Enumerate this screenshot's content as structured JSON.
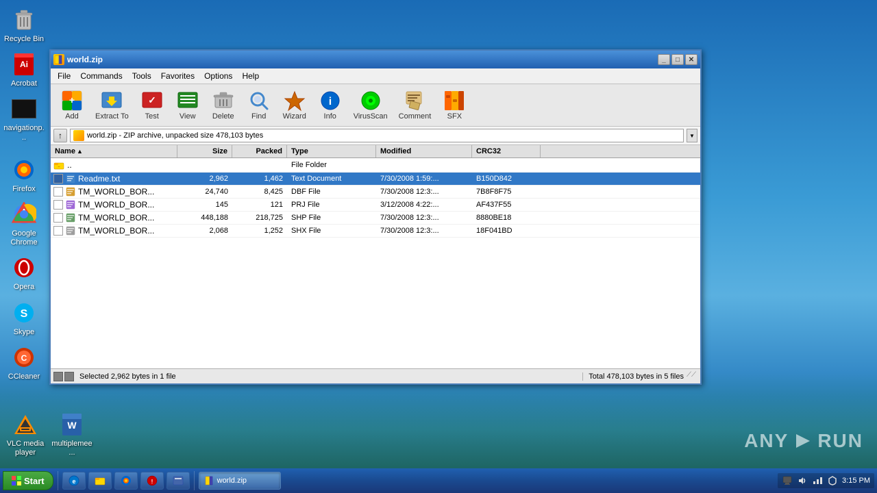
{
  "desktop": {
    "icons": [
      {
        "id": "recycle-bin",
        "label": "Recycle Bin",
        "icon": "🗑"
      },
      {
        "id": "acrobat",
        "label": "Acrobat",
        "icon": "📄"
      },
      {
        "id": "navigation",
        "label": "navigationp...",
        "icon": "⬛"
      },
      {
        "id": "firefox",
        "label": "Firefox",
        "icon": "🦊"
      },
      {
        "id": "google-chrome",
        "label": "Google Chrome",
        "icon": "🌐"
      },
      {
        "id": "opera",
        "label": "Opera",
        "icon": "O"
      },
      {
        "id": "skype",
        "label": "Skype",
        "icon": "S"
      },
      {
        "id": "ccleaner",
        "label": "CCleaner",
        "icon": "C"
      }
    ],
    "bottom_icons": [
      {
        "id": "vlc",
        "label": "VLC media player",
        "icon": "🔶"
      },
      {
        "id": "multiplemee",
        "label": "multiplemee...",
        "icon": "📝"
      }
    ]
  },
  "winrar": {
    "title": "world.zip",
    "address": "world.zip - ZIP archive, unpacked size 478,103 bytes",
    "menus": [
      "File",
      "Commands",
      "Tools",
      "Favorites",
      "Options",
      "Help"
    ],
    "toolbar": [
      {
        "id": "add",
        "label": "Add",
        "icon": "➕"
      },
      {
        "id": "extract-to",
        "label": "Extract To",
        "icon": "📤"
      },
      {
        "id": "test",
        "label": "Test",
        "icon": "✔"
      },
      {
        "id": "view",
        "label": "View",
        "icon": "📋"
      },
      {
        "id": "delete",
        "label": "Delete",
        "icon": "🗑"
      },
      {
        "id": "find",
        "label": "Find",
        "icon": "🔍"
      },
      {
        "id": "wizard",
        "label": "Wizard",
        "icon": "⚡"
      },
      {
        "id": "info",
        "label": "Info",
        "icon": "ℹ"
      },
      {
        "id": "virusscan",
        "label": "VirusScan",
        "icon": "🛡"
      },
      {
        "id": "comment",
        "label": "Comment",
        "icon": "💬"
      },
      {
        "id": "sfx",
        "label": "SFX",
        "icon": "📦"
      }
    ],
    "columns": [
      "Name",
      "Size",
      "Packed",
      "Type",
      "Modified",
      "CRC32"
    ],
    "files": [
      {
        "id": "parent",
        "name": "..",
        "size": "",
        "packed": "",
        "type": "File Folder",
        "modified": "",
        "crc32": "",
        "selected": false,
        "is_parent": true
      },
      {
        "id": "readme",
        "name": "Readme.txt",
        "size": "2,962",
        "packed": "1,462",
        "type": "Text Document",
        "modified": "7/30/2008 1:59:...",
        "crc32": "B150D842",
        "selected": true
      },
      {
        "id": "file2",
        "name": "TM_WORLD_BOR...",
        "size": "24,740",
        "packed": "8,425",
        "type": "DBF File",
        "modified": "7/30/2008 12:3:...",
        "crc32": "7B8F8F75",
        "selected": false
      },
      {
        "id": "file3",
        "name": "TM_WORLD_BOR...",
        "size": "145",
        "packed": "121",
        "type": "PRJ File",
        "modified": "3/12/2008 4:22:...",
        "crc32": "AF437F55",
        "selected": false
      },
      {
        "id": "file4",
        "name": "TM_WORLD_BOR...",
        "size": "448,188",
        "packed": "218,725",
        "type": "SHP File",
        "modified": "7/30/2008 12:3:...",
        "crc32": "8880BE18",
        "selected": false
      },
      {
        "id": "file5",
        "name": "TM_WORLD_BOR...",
        "size": "2,068",
        "packed": "1,252",
        "type": "SHX File",
        "modified": "7/30/2008 12:3:...",
        "crc32": "18F041BD",
        "selected": false
      }
    ],
    "status_left": "Selected 2,962 bytes in 1 file",
    "status_right": "Total 478,103 bytes in 5 files"
  },
  "taskbar": {
    "start_label": "Start",
    "buttons": [
      {
        "id": "ie",
        "label": "🌐",
        "active": false
      },
      {
        "id": "explorer",
        "label": "📁",
        "active": false
      },
      {
        "id": "winzip",
        "label": "📦",
        "active": false
      },
      {
        "id": "firefox-task",
        "label": "🦊",
        "active": false
      },
      {
        "id": "antivirus",
        "label": "🛡",
        "active": false
      },
      {
        "id": "winrar-task",
        "label": "📦 world.zip",
        "active": true
      }
    ],
    "tray": {
      "icons": [
        "🖥",
        "🔊",
        "📡"
      ],
      "time": "3:15 PM"
    }
  },
  "anyrun": {
    "logo": "ANY ▶ RUN"
  }
}
